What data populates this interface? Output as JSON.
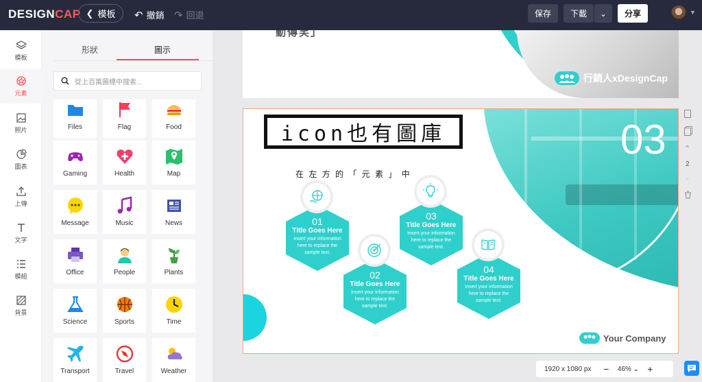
{
  "app": {
    "logo_main": "DESIGN",
    "logo_accent": "CAP"
  },
  "toolbar": {
    "back_label": "模板",
    "undo_label": "撤銷",
    "redo_label": "回退",
    "save_label": "保存",
    "download_label": "下載",
    "share_label": "分享"
  },
  "leftnav": [
    {
      "label": "模板",
      "icon": "layers-icon"
    },
    {
      "label": "元素",
      "icon": "elements-icon"
    },
    {
      "label": "照片",
      "icon": "photo-icon"
    },
    {
      "label": "圖表",
      "icon": "chart-icon"
    },
    {
      "label": "上傳",
      "icon": "upload-icon"
    },
    {
      "label": "文字",
      "icon": "text-icon"
    },
    {
      "label": "模組",
      "icon": "modules-icon"
    },
    {
      "label": "背景",
      "icon": "background-icon"
    }
  ],
  "panel": {
    "tabs": [
      "形狀",
      "圖示"
    ],
    "search_placeholder": "從上百萬圖標中搜索...",
    "tiles": [
      "Files",
      "Flag",
      "Food",
      "Gaming",
      "Health",
      "Map",
      "Message",
      "Music",
      "News",
      "Office",
      "People",
      "Plants",
      "Science",
      "Sports",
      "Time",
      "Transport",
      "Travel",
      "Weather"
    ]
  },
  "page1": {
    "fragment": "動傳笑」",
    "brand": "行銷人xDesignCap"
  },
  "page2": {
    "headline": "icon也有圖庫",
    "sub": "在 左 方 的 「 元 素 」 中",
    "big_number": "03",
    "company": "Your Company",
    "hexes": [
      {
        "num": "01",
        "title": "Title Goes Here",
        "text": "Insert your information here to replace the sample text."
      },
      {
        "num": "02",
        "title": "Title Goes Here",
        "text": "Insert your information here to replace the sample text."
      },
      {
        "num": "03",
        "title": "Title Goes Here",
        "text": "Insert your information here to replace the sample text."
      },
      {
        "num": "04",
        "title": "Title Goes Here",
        "text": "Insert your information here to replace the sample text."
      }
    ]
  },
  "side_tools": {
    "page_number": "2"
  },
  "zoom": {
    "size": "1920 x 1080 px",
    "minus": "−",
    "level": "46%",
    "plus": "+"
  },
  "colors": {
    "accent": "#ff4e4e",
    "teal": "#2fd0cc",
    "topbar": "#272a3d"
  }
}
